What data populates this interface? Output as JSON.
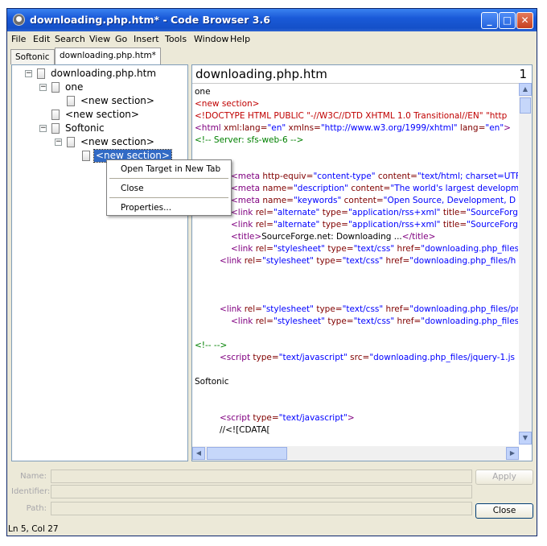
{
  "window": {
    "title": "downloading.php.htm* - Code Browser 3.6",
    "minimize": "_",
    "maximize": "□",
    "close": "✕"
  },
  "menu": [
    "File",
    "Edit",
    "Search",
    "View",
    "Go",
    "Insert",
    "Tools",
    "Window",
    "Help"
  ],
  "tabs": [
    {
      "label": "Softonic",
      "active": false
    },
    {
      "label": "downloading.php.htm*",
      "active": true
    }
  ],
  "tree": {
    "root": "downloading.php.htm",
    "n1": "one",
    "n1_child": "<new section>",
    "n2": "<new section>",
    "n3": "Softonic",
    "n3_child": "<new section>",
    "n3_grandchild": "<new section>"
  },
  "context_menu": {
    "open": "Open Target in New Tab",
    "close": "Close",
    "properties": "Properties..."
  },
  "editor": {
    "title": "downloading.php.htm",
    "number": "1",
    "code": {
      "l1": "one",
      "l2": "<new section>",
      "l3a": "<!DOCTYPE HTML PUBLIC",
      "l3b": " \"-//W3C//DTD XHTML 1.0 Transitional//EN\" \"http",
      "l4a": "<html",
      "l4b": " xml:lang=",
      "l4c": "\"en\"",
      "l4d": " xmlns=",
      "l4e": "\"http://www.w3.org/1999/xhtml\"",
      "l4f": " lang=",
      "l4g": "\"en\"",
      "l4h": ">",
      "l5": "<!-- Server: sfs-web-6 -->",
      "m1a": "<meta",
      "m1b": " http-equiv=",
      "m1c": "\"content-type\"",
      "m1d": " content=",
      "m1e": "\"text/html; charset=UTF",
      "m2a": "<meta",
      "m2b": " name=",
      "m2c": "\"description\"",
      "m2d": " content=",
      "m2e": "\"The world's largest developm",
      "m3a": "<meta",
      "m3b": " name=",
      "m3c": "\"keywords\"",
      "m3d": " content=",
      "m3e": "\"Open Source, Development, D",
      "k1a": "<link",
      "k1b": " rel=",
      "k1c": "\"alternate\"",
      "k1d": " type=",
      "k1e": "\"application/rss+xml\"",
      "k1f": " title=",
      "k1g": "\"SourceForg",
      "k2a": "<link",
      "k2b": " rel=",
      "k2c": "\"alternate\"",
      "k2d": " type=",
      "k2e": "\"application/rss+xml\"",
      "k2f": " title=",
      "k2g": "\"SourceForg",
      "t1a": "<title>",
      "t1b": "SourceForge.net: Downloading ...",
      "t1c": "</title>",
      "s1a": "<link",
      "s1b": " rel=",
      "s1c": "\"stylesheet\"",
      "s1d": " type=",
      "s1e": "\"text/css\"",
      "s1f": " href=",
      "s1g": "\"downloading.php_files",
      "s2a": "<link",
      "s2b": " rel=",
      "s2c": "\"stylesheet\"",
      "s2d": " type=",
      "s2e": "\"text/css\"",
      "s2f": " href=",
      "s2g": "\"downloading.php_files/h",
      "s3a": "<link",
      "s3b": " rel=",
      "s3c": "\"stylesheet\"",
      "s3d": " type=",
      "s3e": "\"text/css\"",
      "s3f": " href=",
      "s3g": "\"downloading.php_files/pr",
      "s4a": "<link",
      "s4b": " rel=",
      "s4c": "\"stylesheet\"",
      "s4d": " type=",
      "s4e": "\"text/css\"",
      "s4f": " href=",
      "s4g": "\"downloading.php_files",
      "c1": "<!--   -->",
      "j1a": "<script",
      "j1b": " type=",
      "j1c": "\"text/javascript\"",
      "j1d": " src=",
      "j1e": "\"downloading.php_files/jquery-1.js",
      "sec": "Softonic",
      "j2a": "<script",
      "j2b": " type=",
      "j2c": "\"text/javascript\"",
      "j2d": ">",
      "cd": "//<![CDATA["
    }
  },
  "fields": {
    "name_label": "Name:",
    "identifier_label": "Identifier:",
    "path_label": "Path:",
    "apply": "Apply",
    "close": "Close"
  },
  "status": "Ln 5, Col 27"
}
